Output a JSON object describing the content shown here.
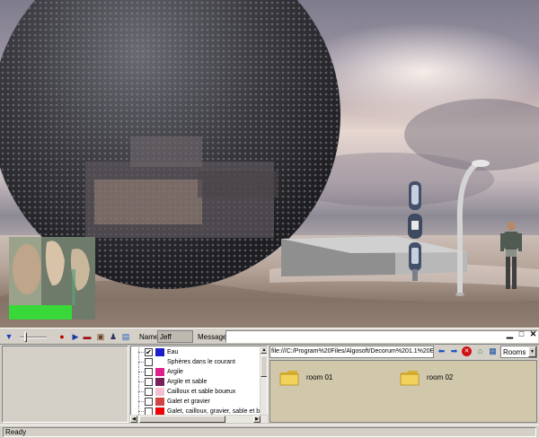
{
  "toolbar": {
    "name_label": "Name:",
    "name_value": "Jeff",
    "message_label": "Message:",
    "message_value": ""
  },
  "materials": {
    "items": [
      {
        "label": "Eau",
        "checked": true,
        "color": "#1e1ec8"
      },
      {
        "label": "Sphères dans le courant",
        "checked": false,
        "color": "#ffffff"
      },
      {
        "label": "Argile",
        "checked": false,
        "color": "#e0208a"
      },
      {
        "label": "Argile et sable",
        "checked": false,
        "color": "#7a1e5a"
      },
      {
        "label": "Cailloux et sable boueux",
        "checked": false,
        "color": "#f2c0d0"
      },
      {
        "label": "Galet et gravier",
        "checked": false,
        "color": "#d04444"
      },
      {
        "label": "Galet, cailloux, gravier, sable et bou",
        "checked": false,
        "color": "#f00000"
      }
    ]
  },
  "browser": {
    "url": "file:///C:/Program%20Files/Algosoft/Decorum%201.1%20En",
    "rooms_select": "Rooms",
    "folders": [
      {
        "label": "room 01"
      },
      {
        "label": "room 02"
      }
    ]
  },
  "status": {
    "text": "Ready"
  },
  "colors": {
    "browser_bg": "#d1c8ac",
    "folder": "#f0d050",
    "panel": "#d4d0c8"
  },
  "icons": [
    "triangle-down-icon",
    "record-icon",
    "play-icon",
    "stop-icon",
    "briefcase-icon",
    "person-icon",
    "chart-icon",
    "refresh-icon",
    "back-arrow-icon",
    "forward-arrow-icon",
    "stop-sign-icon",
    "home-icon",
    "save-icon"
  ]
}
